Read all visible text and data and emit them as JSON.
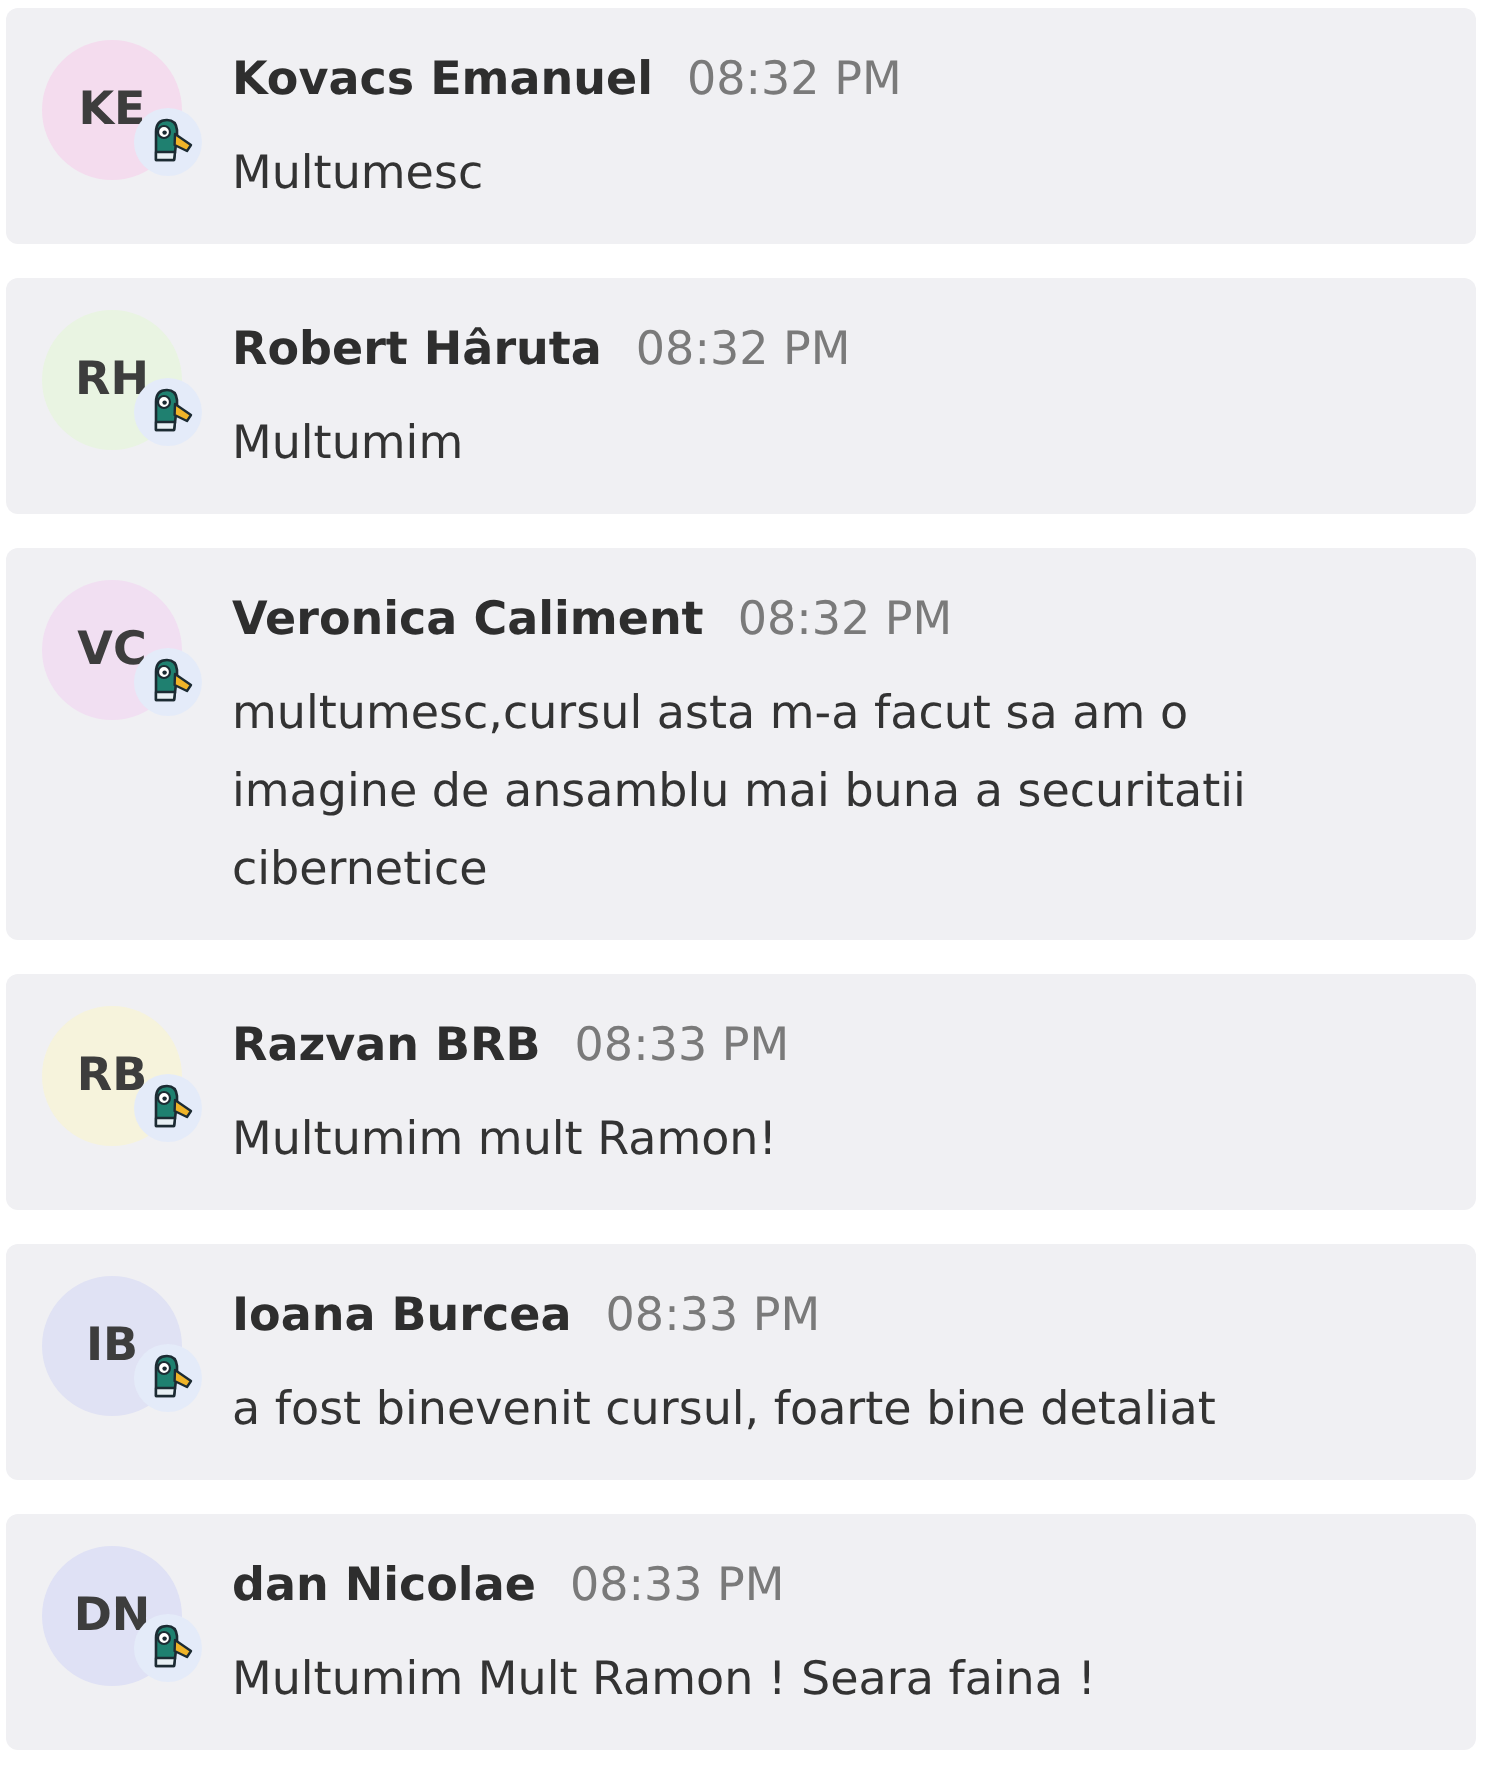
{
  "messages": [
    {
      "avatar": {
        "initials": "KE",
        "color": "#f4dcee"
      },
      "name": "Kovacs Emanuel",
      "time": "08:32 PM",
      "text": "Multumesc"
    },
    {
      "avatar": {
        "initials": "RH",
        "color": "#e9f4e2"
      },
      "name": "Robert Hâruta",
      "time": "08:32 PM",
      "text": "Multumim"
    },
    {
      "avatar": {
        "initials": "VC",
        "color": "#f1dff2"
      },
      "name": "Veronica Caliment",
      "time": "08:32 PM",
      "text": "multumesc,cursul asta m-a facut sa am o imagine de ansamblu mai buna a securitatii cibernetice"
    },
    {
      "avatar": {
        "initials": "RB",
        "color": "#f6f3dc"
      },
      "name": "Razvan BRB",
      "time": "08:33 PM",
      "text": "Multumim mult Ramon!"
    },
    {
      "avatar": {
        "initials": "IB",
        "color": "#e0e2f4"
      },
      "name": "Ioana Burcea",
      "time": "08:33 PM",
      "text": "a fost binevenit cursul, foarte bine detaliat"
    },
    {
      "avatar": {
        "initials": "DN",
        "color": "#dfe1f5"
      },
      "name": "dan Nicolae",
      "time": "08:33 PM",
      "text": "Multumim Mult Ramon ! Seara faina !"
    }
  ]
}
